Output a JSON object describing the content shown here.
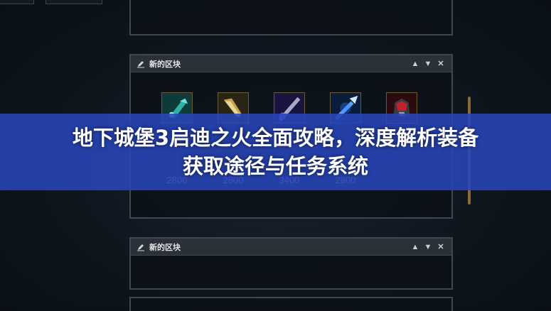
{
  "panels": [
    {
      "title": "新的区块",
      "items": [
        {
          "icon": "teal-blade-icon",
          "price": "2800"
        },
        {
          "icon": "golden-axe-icon",
          "price": "2800"
        },
        {
          "icon": "purple-sword-icon",
          "price": "3400"
        },
        {
          "icon": "blue-spear-icon",
          "price": "2800"
        },
        {
          "icon": "red-helmet-icon",
          "price": ""
        }
      ]
    },
    {
      "title": "新的区块"
    }
  ],
  "banner": {
    "line1": "地下城堡3启迪之火全面攻略，深度解析装备",
    "line2": "获取途径与任务系统"
  },
  "controls": {
    "up": "▲",
    "down": "▼",
    "close": "✕"
  }
}
